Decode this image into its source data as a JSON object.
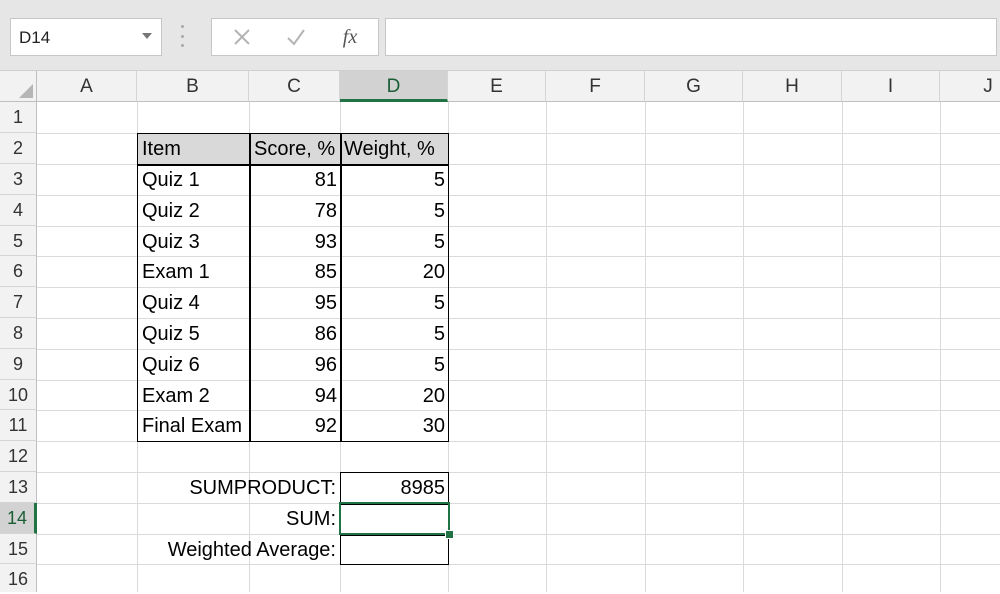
{
  "formula_bar": {
    "name_box": "D14",
    "fx_label": "fx",
    "formula": ""
  },
  "columns": [
    "A",
    "B",
    "C",
    "D",
    "E",
    "F",
    "G",
    "H",
    "I",
    "J"
  ],
  "rows": [
    "1",
    "2",
    "3",
    "4",
    "5",
    "6",
    "7",
    "8",
    "9",
    "10",
    "11",
    "12",
    "13",
    "14",
    "15",
    "16"
  ],
  "table": {
    "headers": [
      "Item",
      "Score, %",
      "Weight, %"
    ],
    "rows": [
      {
        "item": "Quiz 1",
        "score": "81",
        "weight": "5"
      },
      {
        "item": "Quiz 2",
        "score": "78",
        "weight": "5"
      },
      {
        "item": "Quiz 3",
        "score": "93",
        "weight": "5"
      },
      {
        "item": "Exam 1",
        "score": "85",
        "weight": "20"
      },
      {
        "item": "Quiz 4",
        "score": "95",
        "weight": "5"
      },
      {
        "item": "Quiz 5",
        "score": "86",
        "weight": "5"
      },
      {
        "item": "Quiz 6",
        "score": "96",
        "weight": "5"
      },
      {
        "item": "Exam 2",
        "score": "94",
        "weight": "20"
      },
      {
        "item": "Final Exam",
        "score": "92",
        "weight": "30"
      }
    ]
  },
  "summary": {
    "sumproduct_label": "SUMPRODUCT:",
    "sumproduct_value": "8985",
    "sum_label": "SUM:",
    "sum_value": "",
    "weighted_label": "Weighted Average:",
    "weighted_value": ""
  },
  "selection": {
    "cell": "D14",
    "color": "#217346"
  },
  "colors": {
    "header_fill": "#d9d9d9",
    "accent": "#217346"
  }
}
